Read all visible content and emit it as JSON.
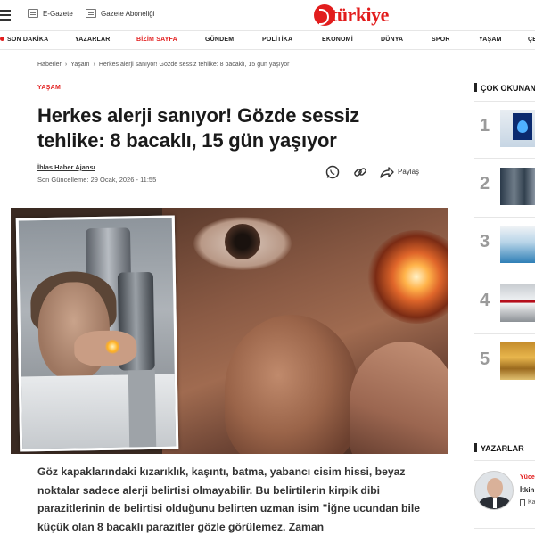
{
  "header": {
    "egazete_label": "E-Gazete",
    "abonelik_label": "Gazete Aboneliği",
    "logo_text": "türkiye"
  },
  "nav": {
    "items": [
      "SON DAKİKA",
      "YAZARLAR",
      "BİZİM SAYFA",
      "GÜNDEM",
      "POLİTİKA",
      "EKONOMİ",
      "DÜNYA",
      "SPOR",
      "YAŞAM",
      "ÇE"
    ]
  },
  "breadcrumb": {
    "items": [
      "Haberler",
      "Yaşam",
      "Herkes alerji sanıyor! Gözde sessiz tehlike: 8 bacaklı, 15 gün yaşıyor"
    ]
  },
  "article": {
    "category": "YAŞAM",
    "title": "Herkes alerji sanıyor! Gözde sessiz tehlike: 8 bacaklı, 15 gün yaşıyor",
    "author": "İhlas Haber Ajansı",
    "updated": "Son Güncelleme: 29 Ocak, 2026 - 11:55",
    "share_label": "Paylaş",
    "lead": "Göz kapaklarındaki kızarıklık, kaşıntı, batma, yabancı cisim hissi, beyaz noktalar sadece alerji belirtisi olmayabilir. Bu belirtilerin kirpik dibi parazitlerinin de belirtisi olduğunu belirten uzman isim \"İğne ucundan bile küçük olan 8 bacaklı parazitler gözle görülemez. Zaman"
  },
  "sidebar": {
    "popular_title": "ÇOK OKUNAN",
    "popular": [
      {
        "rank": "1"
      },
      {
        "rank": "2"
      },
      {
        "rank": "3"
      },
      {
        "rank": "4"
      },
      {
        "rank": "5"
      }
    ],
    "writers_title": "YAZARLAR",
    "writer_name": "Yüce",
    "writer_title": "İtkin",
    "writer_small": "Ka"
  },
  "colors": {
    "brand": "#e21d1d",
    "text": "#1a1a1a"
  }
}
